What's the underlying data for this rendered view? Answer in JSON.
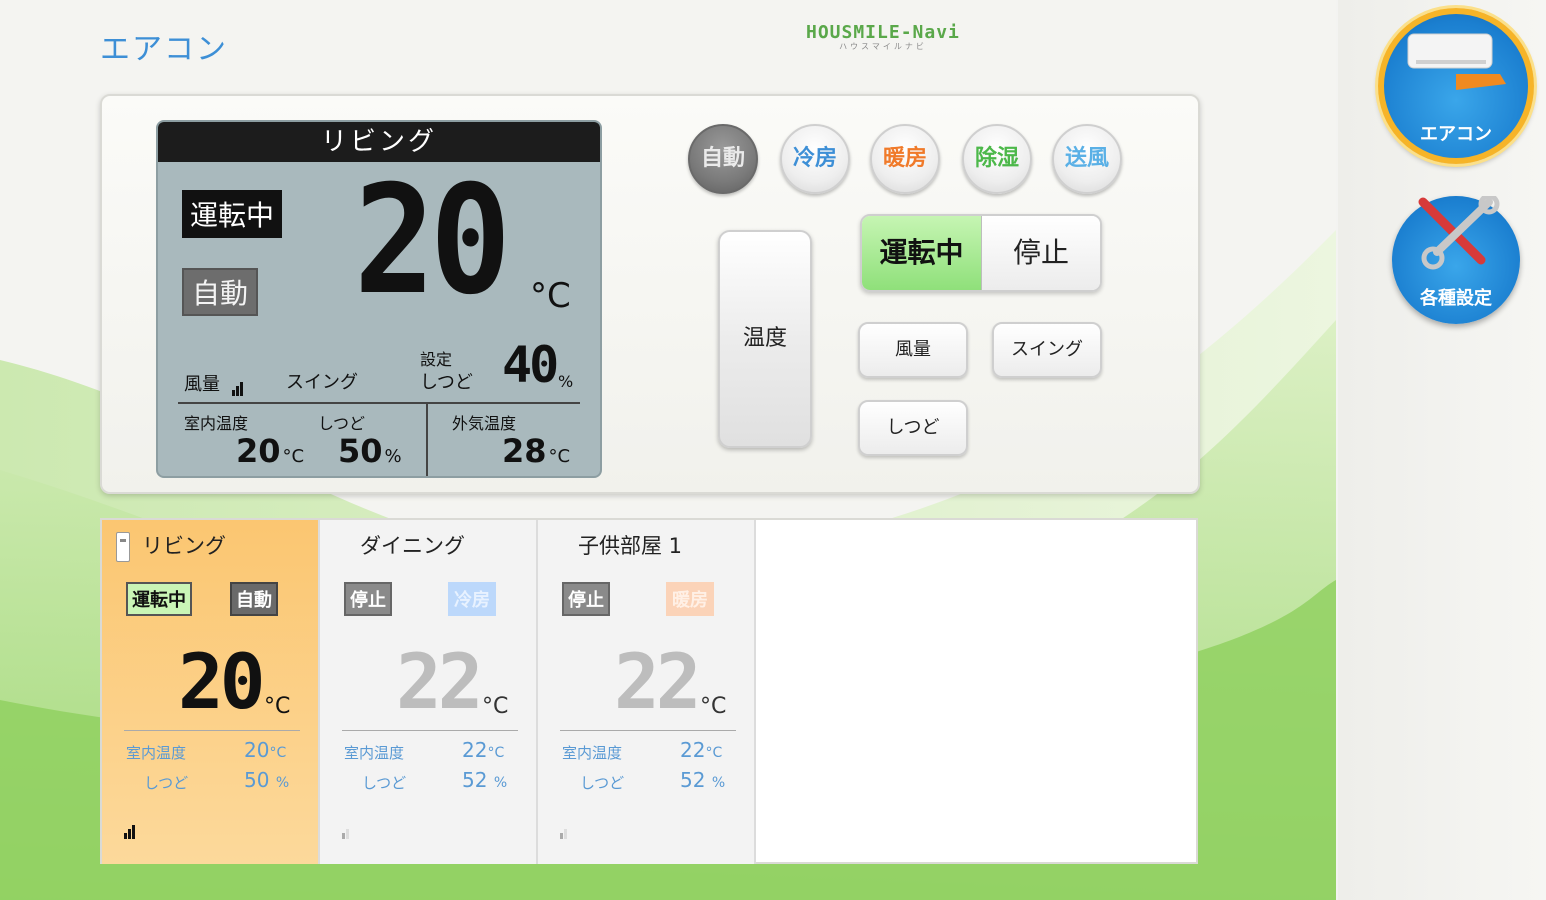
{
  "header": {
    "title": "エアコン",
    "logo_text": "HOUSMILE-Navi",
    "logo_sub": "ハウスマイルナビ"
  },
  "colors": {
    "accent_blue": "#3d8fd6",
    "running_green": "#8fe07a",
    "selected_card": "#fbc671",
    "rail_ring": "#f6b428"
  },
  "lcd": {
    "room": "リビング",
    "status": "運転中",
    "mode": "自動",
    "set_temp": "20",
    "unit": "°C",
    "fan_label": "風量",
    "swing_label": "スイング",
    "set_label": "設定",
    "humidity_label": "しつど",
    "set_humidity": "40",
    "percent": "%",
    "indoor_temp_label": "室内温度",
    "indoor_temp": "20",
    "indoor_humidity_label": "しつど",
    "indoor_humidity": "50",
    "outdoor_temp_label": "外気温度",
    "outdoor_temp": "28",
    "temp_unit_small": "°C",
    "fan_level": 3
  },
  "modes": [
    {
      "label": "自動",
      "color": "#eaeaea",
      "active": true
    },
    {
      "label": "冷房",
      "color": "#3d8fd6",
      "active": false
    },
    {
      "label": "暖房",
      "color": "#f07a2a",
      "active": false
    },
    {
      "label": "除湿",
      "color": "#4cb84a",
      "active": false
    },
    {
      "label": "送風",
      "color": "#5ab0e6",
      "active": false
    }
  ],
  "controls": {
    "temp_label": "温度",
    "power_on_label": "運転中",
    "power_off_label": "停止",
    "fan_label": "風量",
    "swing_label": "スイング",
    "humidity_label": "しつど"
  },
  "rooms": [
    {
      "name": "リビング",
      "status": "運転中",
      "mode": "自動",
      "set_temp": "20",
      "unit": "°C",
      "indoor_temp_label": "室内温度",
      "indoor_temp": "20",
      "indoor_temp_unit": "°C",
      "humidity_label": "しつど",
      "humidity": "50",
      "humidity_unit": "%"
    },
    {
      "name": "ダイニング",
      "status": "停止",
      "mode": "冷房",
      "set_temp": "22",
      "unit": "°C",
      "indoor_temp_label": "室内温度",
      "indoor_temp": "22",
      "indoor_temp_unit": "°C",
      "humidity_label": "しつど",
      "humidity": "52",
      "humidity_unit": "%"
    },
    {
      "name": "子供部屋 1",
      "status": "停止",
      "mode": "暖房",
      "set_temp": "22",
      "unit": "°C",
      "indoor_temp_label": "室内温度",
      "indoor_temp": "22",
      "indoor_temp_unit": "°C",
      "humidity_label": "しつど",
      "humidity": "52",
      "humidity_unit": "%"
    }
  ],
  "rail": {
    "aircon_label": "エアコン",
    "aircon_icon": "aircon-icon",
    "settings_label": "各種設定",
    "settings_icon": "tools-icon"
  }
}
